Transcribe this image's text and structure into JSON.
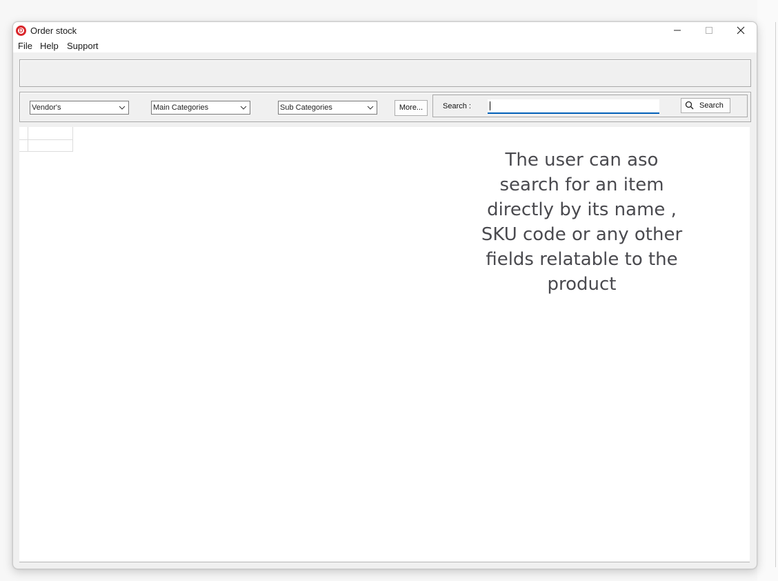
{
  "window": {
    "title": "Order stock",
    "icon": "app-logo-icon",
    "icon_letter": "D",
    "controls": [
      "minimize-icon",
      "maximize-icon",
      "close-icon"
    ]
  },
  "menubar": {
    "items": [
      "File",
      "Help",
      "Support"
    ]
  },
  "filters": {
    "vendor": "Vendor's",
    "main_category": "Main Categories",
    "sub_category": "Sub Categories",
    "more_label": "More..."
  },
  "search": {
    "label": "Search :",
    "value": "",
    "button_label": "Search"
  },
  "annotation": {
    "text": "The user can aso search for an item directly by its name , SKU code or any other fields relatable to the product"
  },
  "colors": {
    "brand": "#d9262b",
    "focus": "#005fb8"
  }
}
